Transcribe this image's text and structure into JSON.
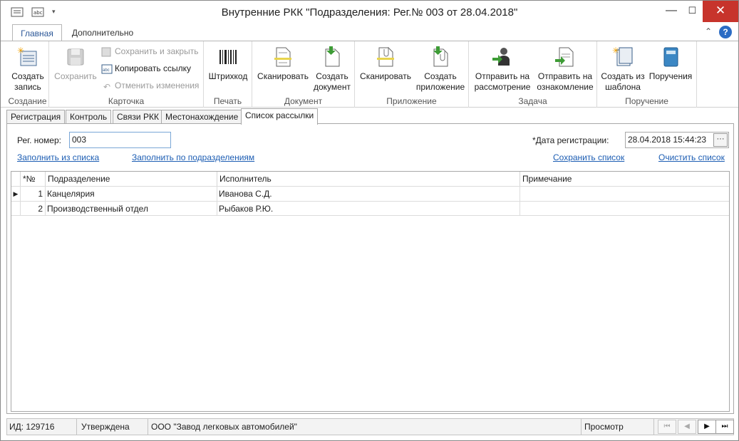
{
  "window": {
    "title": "Внутренние РКК \"Подразделения: Рег.№ 003 от 28.04.2018\"",
    "controls": {
      "minimize": "—",
      "maximize": "☐",
      "close": "✕"
    }
  },
  "ribbon_tabs": {
    "home": "Главная",
    "extra": "Дополнительно"
  },
  "ribbon": {
    "groups": {
      "create": "Создание",
      "card": "Карточка",
      "print": "Печать",
      "document": "Документ",
      "attachment": "Приложение",
      "task": "Задача",
      "assignment": "Поручение"
    },
    "create_record": [
      "Создать",
      "запись"
    ],
    "save": "Сохранить",
    "save_close": "Сохранить и закрыть",
    "copy_link": "Копировать ссылку",
    "cancel_changes": "Отменить изменения",
    "barcode": "Штрихкод",
    "doc_scan": "Сканировать",
    "doc_create": [
      "Создать",
      "документ"
    ],
    "att_scan": "Сканировать",
    "att_create": [
      "Создать",
      "приложение"
    ],
    "send_review": [
      "Отправить на",
      "рассмотрение"
    ],
    "send_familiar": [
      "Отправить на",
      "ознакомление"
    ],
    "create_from_template": [
      "Создать из",
      "шаблона"
    ],
    "assignments": "Поручения",
    "accent": "#2b5797"
  },
  "doc_tabs": [
    "Регистрация",
    "Контроль",
    "Связи РКК",
    "Местонахождение",
    "Список рассылки"
  ],
  "form": {
    "reg_label": "Рег. номер:",
    "reg_value": "003",
    "date_label": "*Дата регистрации:",
    "date_value": "28.04.2018 15:44:23",
    "date_btn": "···",
    "link_fill_list": "Заполнить из списка",
    "link_fill_dept": "Заполнить по подразделениям",
    "link_save_list": "Сохранить список",
    "link_clear_list": "Очистить список"
  },
  "grid": {
    "columns": [
      "*№",
      "Подразделение",
      "Исполнитель",
      "Примечание"
    ],
    "rows": [
      {
        "n": "1",
        "dept": "Канцелярия",
        "exec": "Иванова С.Д.",
        "note": ""
      },
      {
        "n": "2",
        "dept": "Производственный отдел",
        "exec": "Рыбаков Р.Ю.",
        "note": ""
      }
    ]
  },
  "status": {
    "id": "ИД: 129716",
    "state": "Утверждена",
    "org": "ООО \"Завод легковых автомобилей\"",
    "mode": "Просмотр"
  }
}
